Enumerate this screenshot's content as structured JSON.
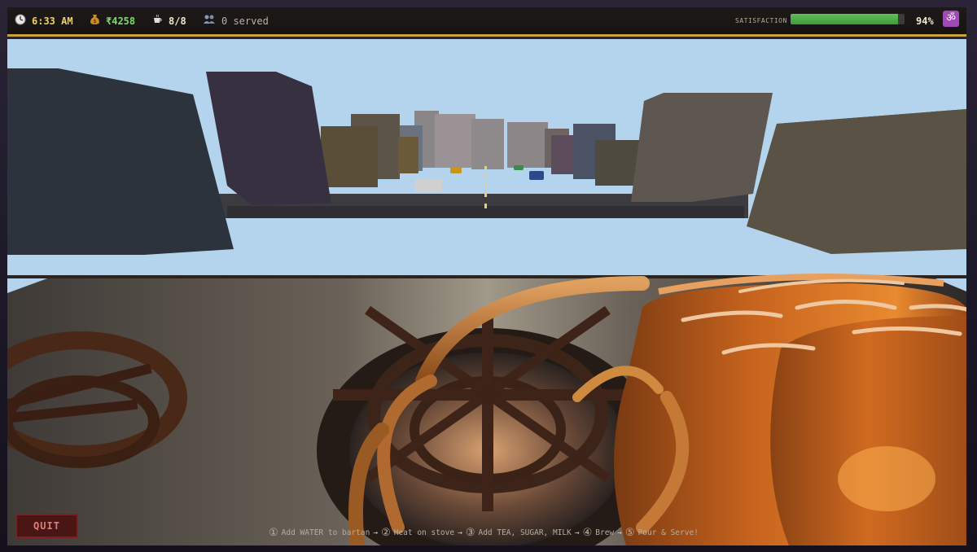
{
  "hud": {
    "time": "6:33 AM",
    "time_icon": "clock-icon",
    "money": "₹4258",
    "money_icon": "money-bag-icon",
    "cups": "8/8",
    "cups_icon": "chai-cup-icon",
    "served": "0 served",
    "served_icon": "customers-icon",
    "satisfaction_label": "SATISFACTION",
    "satisfaction_value": 0.94,
    "satisfaction_pct": "94%",
    "om_symbol": "ॐ",
    "om_icon": "om-icon"
  },
  "controls": {
    "quit_label": "QUIT"
  },
  "instructions": {
    "steps": [
      {
        "num": "①",
        "text": "Add WATER to bartan"
      },
      {
        "num": "②",
        "text": "Heat on stove"
      },
      {
        "num": "③",
        "text": "Add TEA, SUGAR, MILK"
      },
      {
        "num": "④",
        "text": "Brew"
      },
      {
        "num": "⑤",
        "text": "Pour & Serve!"
      }
    ],
    "arrow": "→"
  },
  "colors": {
    "accent": "#c9a23a",
    "money": "#7ddc6a",
    "satisfaction": "#4faa4a",
    "quit": "#4a1515",
    "sky": "#b3d4ec"
  }
}
